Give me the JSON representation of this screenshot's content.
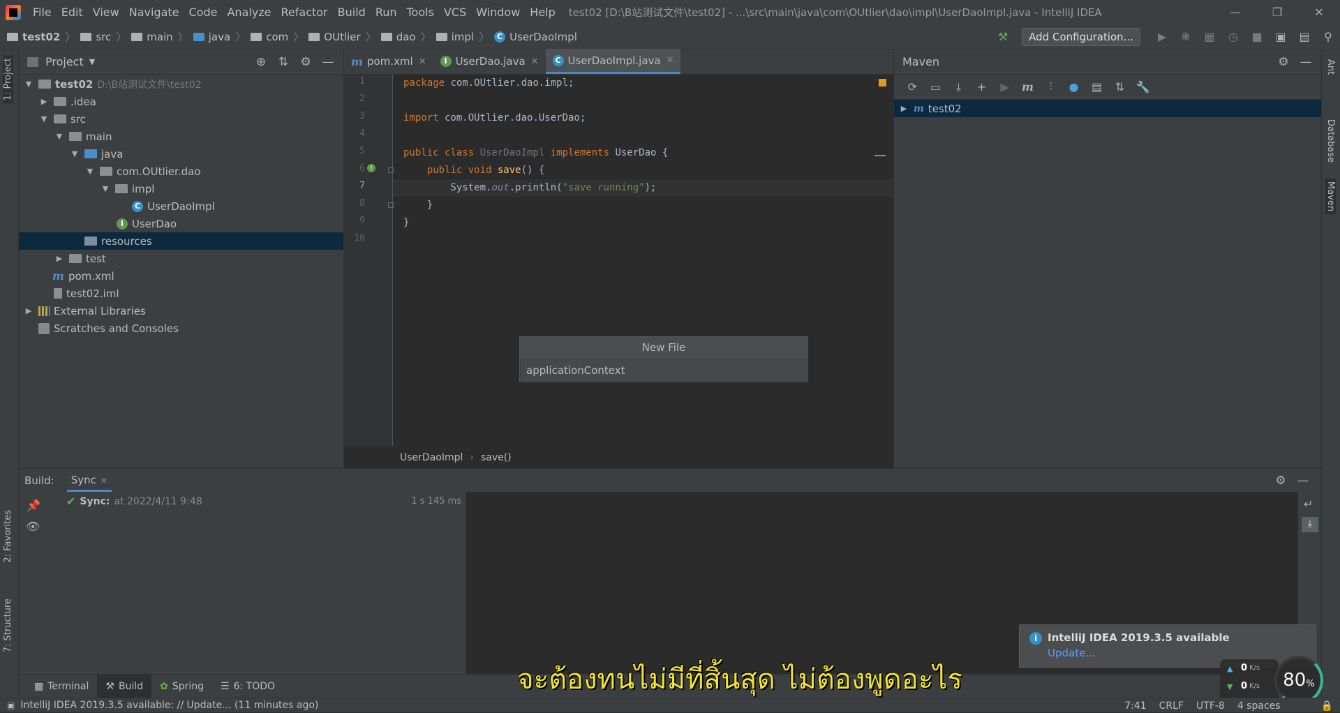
{
  "window": {
    "title": "test02 [D:\\B站测试文件\\test02] - ...\\src\\main\\java\\com\\OUtlier\\dao\\impl\\UserDaoImpl.java - IntelliJ IDEA",
    "menu": [
      "File",
      "Edit",
      "View",
      "Navigate",
      "Code",
      "Analyze",
      "Refactor",
      "Build",
      "Run",
      "Tools",
      "VCS",
      "Window",
      "Help"
    ]
  },
  "navbar": {
    "crumbs": [
      "test02",
      "src",
      "main",
      "java",
      "com",
      "OUtlier",
      "dao",
      "impl",
      "UserDaoImpl"
    ],
    "add_configuration": "Add Configuration..."
  },
  "left_strip": {
    "project_tab": "1: Project",
    "favorites_tab": "2: Favorites",
    "structure_tab": "7: Structure"
  },
  "right_strip": {
    "ant_tab": "Ant",
    "database_tab": "Database",
    "maven_tab": "Maven"
  },
  "project": {
    "header": "Project",
    "tree": [
      {
        "label": "test02",
        "extra": "D:\\B站测试文件\\test02"
      },
      {
        "label": ".idea"
      },
      {
        "label": "src"
      },
      {
        "label": "main"
      },
      {
        "label": "java"
      },
      {
        "label": "com.OUtlier.dao"
      },
      {
        "label": "impl"
      },
      {
        "label": "UserDaoImpl"
      },
      {
        "label": "UserDao"
      },
      {
        "label": "resources"
      },
      {
        "label": "test"
      },
      {
        "label": "pom.xml"
      },
      {
        "label": "test02.iml"
      },
      {
        "label": "External Libraries"
      },
      {
        "label": "Scratches and Consoles"
      }
    ]
  },
  "editor": {
    "tabs": [
      "pom.xml",
      "UserDao.java",
      "UserDaoImpl.java"
    ],
    "active_tab": "UserDaoImpl.java",
    "line_numbers": [
      "1",
      "2",
      "3",
      "4",
      "5",
      "6",
      "7",
      "8",
      "9",
      "10"
    ],
    "code": {
      "l1_kw": "package",
      "l1_rest": " com.OUtlier.dao.impl;",
      "l3_kw": "import",
      "l3_rest": " com.OUtlier.dao.UserDao;",
      "l5_kw1": "public class ",
      "l5_cls": "UserDaoImpl",
      "l5_kw2": " implements",
      "l5_rest": " UserDao {",
      "l6_kw": "    public void ",
      "l6_fn": "save",
      "l6_rest": "() {",
      "l7_a": "        System.",
      "l7_out": "out",
      "l7_b": ".println(",
      "l7_str": "\"save running\"",
      "l7_c": ");",
      "l8": "    }",
      "l9": "}"
    },
    "breadcrumb": [
      "UserDaoImpl",
      "save()"
    ]
  },
  "maven": {
    "header": "Maven",
    "project": "test02"
  },
  "new_file_popup": {
    "title": "New File",
    "value": "applicationContext"
  },
  "build": {
    "label": "Build:",
    "tab": "Sync",
    "sync_label": "Sync:",
    "sync_time": "at 2022/4/11 9:48",
    "duration": "1 s 145 ms"
  },
  "bottom_tabs": [
    "Terminal",
    "Build",
    "Spring",
    "6: TODO"
  ],
  "notification": {
    "title": "IntelliJ IDEA 2019.3.5 available",
    "link": "Update..."
  },
  "statusbar": {
    "message": "IntelliJ IDEA 2019.3.5 available: // Update... (11 minutes ago)",
    "position": "7:41",
    "line_sep": "CRLF",
    "encoding": "UTF-8",
    "indent": "4 spaces"
  },
  "subtitle": "จะต้องทนไม่มีที่สิ้นสุด ไม่ต้องพูดอะไร",
  "speed_widget": {
    "up": "0",
    "down": "0",
    "unit": "K/s",
    "percent": "80",
    "percent_sign": "%"
  },
  "colors": {
    "accent": "#4a88c7",
    "selection": "#0d293e",
    "subtitle": "#f2e32b"
  }
}
